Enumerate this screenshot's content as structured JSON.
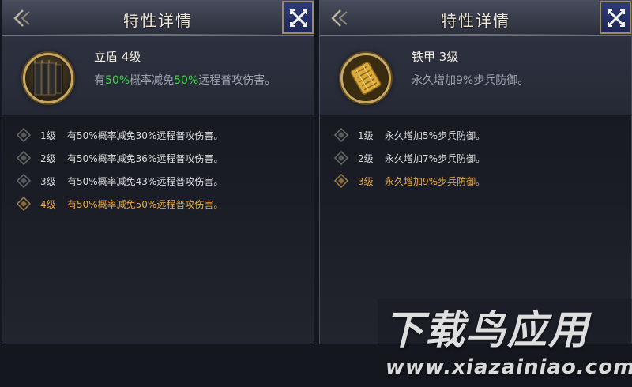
{
  "colors": {
    "highlight_green": "#3fd44a",
    "active_level_orange": "#e6a94a",
    "title_text": "#ece6d6",
    "close_button_blue": "#2f3b7a"
  },
  "panels": [
    {
      "title": "特性详情",
      "skill_name": "立盾  4级",
      "skill_desc_parts": [
        "有",
        "50%",
        "概率减免",
        "50%",
        "远程普攻伤害。"
      ],
      "icon": "tower-shield-icon",
      "levels": [
        {
          "level": "1级",
          "desc": "有50%概率减免30%远程普攻伤害。",
          "active": false
        },
        {
          "level": "2级",
          "desc": "有50%概率减免36%远程普攻伤害。",
          "active": false
        },
        {
          "level": "3级",
          "desc": "有50%概率减免43%远程普攻伤害。",
          "active": false
        },
        {
          "level": "4级",
          "desc": "有50%概率减免50%远程普攻伤害。",
          "active": true
        }
      ]
    },
    {
      "title": "特性详情",
      "skill_name": "铁甲  3级",
      "skill_desc": "永久增加9%步兵防御。",
      "icon": "iron-armor-icon",
      "levels": [
        {
          "level": "1级",
          "desc": "永久增加5%步兵防御。",
          "active": false
        },
        {
          "level": "2级",
          "desc": "永久增加7%步兵防御。",
          "active": false
        },
        {
          "level": "3级",
          "desc": "永久增加9%步兵防御。",
          "active": true
        }
      ]
    }
  ],
  "watermark": {
    "main": "下载鸟应用",
    "url": "www.xiazainiao.com"
  }
}
